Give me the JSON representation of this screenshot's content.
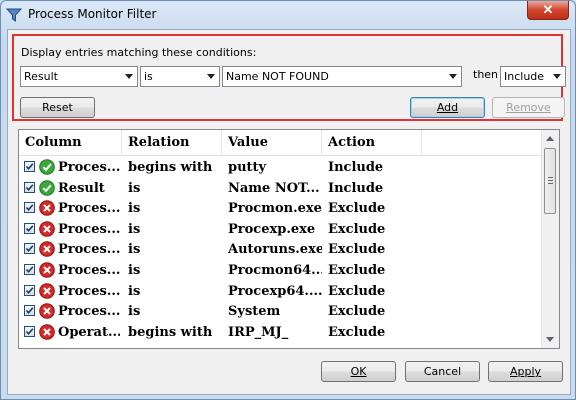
{
  "window": {
    "title": "Process Monitor Filter",
    "close_label": "✕"
  },
  "conditions": {
    "label": "Display entries matching these conditions:",
    "column_value": "Result",
    "relation_value": "is",
    "value_value": "Name NOT FOUND",
    "then_label": "then",
    "action_value": "Include",
    "reset_label": "Reset",
    "add_label": "Add",
    "remove_label": "Remove"
  },
  "table": {
    "headers": [
      "Column",
      "Relation",
      "Value",
      "Action"
    ],
    "rows": [
      {
        "column": "Proces...",
        "relation": "begins with",
        "value": "putty",
        "action": "Include",
        "status": "include",
        "checked": true
      },
      {
        "column": "Result",
        "relation": "is",
        "value": "Name NOT...",
        "action": "Include",
        "status": "include",
        "checked": true
      },
      {
        "column": "Proces...",
        "relation": "is",
        "value": "Procmon.exe",
        "action": "Exclude",
        "status": "exclude",
        "checked": true
      },
      {
        "column": "Proces...",
        "relation": "is",
        "value": "Procexp.exe",
        "action": "Exclude",
        "status": "exclude",
        "checked": true
      },
      {
        "column": "Proces...",
        "relation": "is",
        "value": "Autoruns.exe",
        "action": "Exclude",
        "status": "exclude",
        "checked": true
      },
      {
        "column": "Proces...",
        "relation": "is",
        "value": "Procmon64....",
        "action": "Exclude",
        "status": "exclude",
        "checked": true
      },
      {
        "column": "Proces...",
        "relation": "is",
        "value": "Procexp64....",
        "action": "Exclude",
        "status": "exclude",
        "checked": true
      },
      {
        "column": "Proces...",
        "relation": "is",
        "value": "System",
        "action": "Exclude",
        "status": "exclude",
        "checked": true
      },
      {
        "column": "Operat...",
        "relation": "begins with",
        "value": "IRP_MJ_",
        "action": "Exclude",
        "status": "exclude",
        "checked": true
      }
    ]
  },
  "footer": {
    "ok_label": "OK",
    "cancel_label": "Cancel",
    "apply_label": "Apply"
  },
  "colors": {
    "highlight_frame": "#e03236",
    "include_icon": "#3aa83a",
    "exclude_icon": "#d42a2a"
  }
}
